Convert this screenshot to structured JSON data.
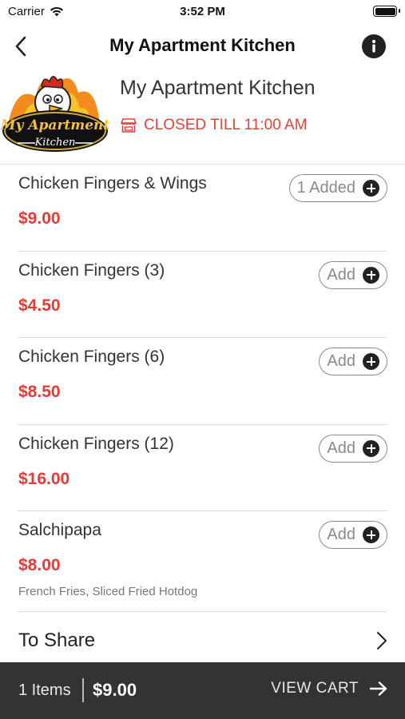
{
  "status_bar": {
    "carrier": "Carrier",
    "time": "3:52 PM"
  },
  "nav": {
    "title": "My Apartment Kitchen"
  },
  "restaurant": {
    "name": "My Apartment Kitchen",
    "status": "CLOSED TILL 11:00 AM",
    "logo_text_line1": "My Apartment",
    "logo_text_line2": "Kitchen",
    "status_color": "#e5413a"
  },
  "menu": {
    "items": [
      {
        "name": "Chicken Fingers & Wings",
        "price": "$9.00",
        "button": "1 Added"
      },
      {
        "name": "Chicken Fingers (3)",
        "price": "$4.50",
        "button": "Add"
      },
      {
        "name": "Chicken Fingers (6)",
        "price": "$8.50",
        "button": "Add"
      },
      {
        "name": "Chicken Fingers (12)",
        "price": "$16.00",
        "button": "Add"
      },
      {
        "name": "Salchipapa",
        "price": "$8.00",
        "button": "Add",
        "description": "French Fries, Sliced Fried Hotdog"
      }
    ],
    "next_section": "To Share"
  },
  "cart": {
    "count": "1 Items",
    "total": "$9.00",
    "view_label": "VIEW CART"
  },
  "colors": {
    "accent": "#e53a35",
    "cart_bar": "#333333"
  }
}
